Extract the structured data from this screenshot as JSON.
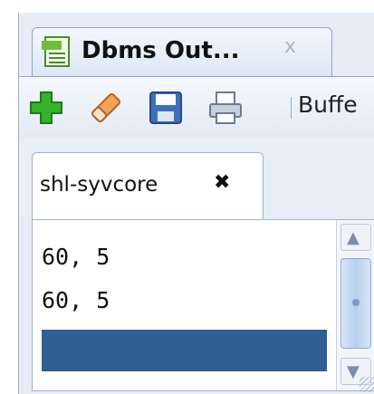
{
  "view_tab": {
    "title": "Dbms Out...",
    "close_glyph": "x",
    "icon": "dbms-output-icon"
  },
  "toolbar": {
    "add_icon": "plus-icon",
    "clear_icon": "eraser-icon",
    "save_icon": "save-icon",
    "print_icon": "print-icon",
    "buffer_label": "Buffe"
  },
  "connection_tab": {
    "label": "shl-syvcore",
    "close_glyph": "✖"
  },
  "output": {
    "lines": [
      "60, 5",
      "60, 5",
      ""
    ]
  },
  "colors": {
    "selection": "#2f5f94",
    "add": "#36b22c",
    "accent_border": "#8ea6c8"
  }
}
